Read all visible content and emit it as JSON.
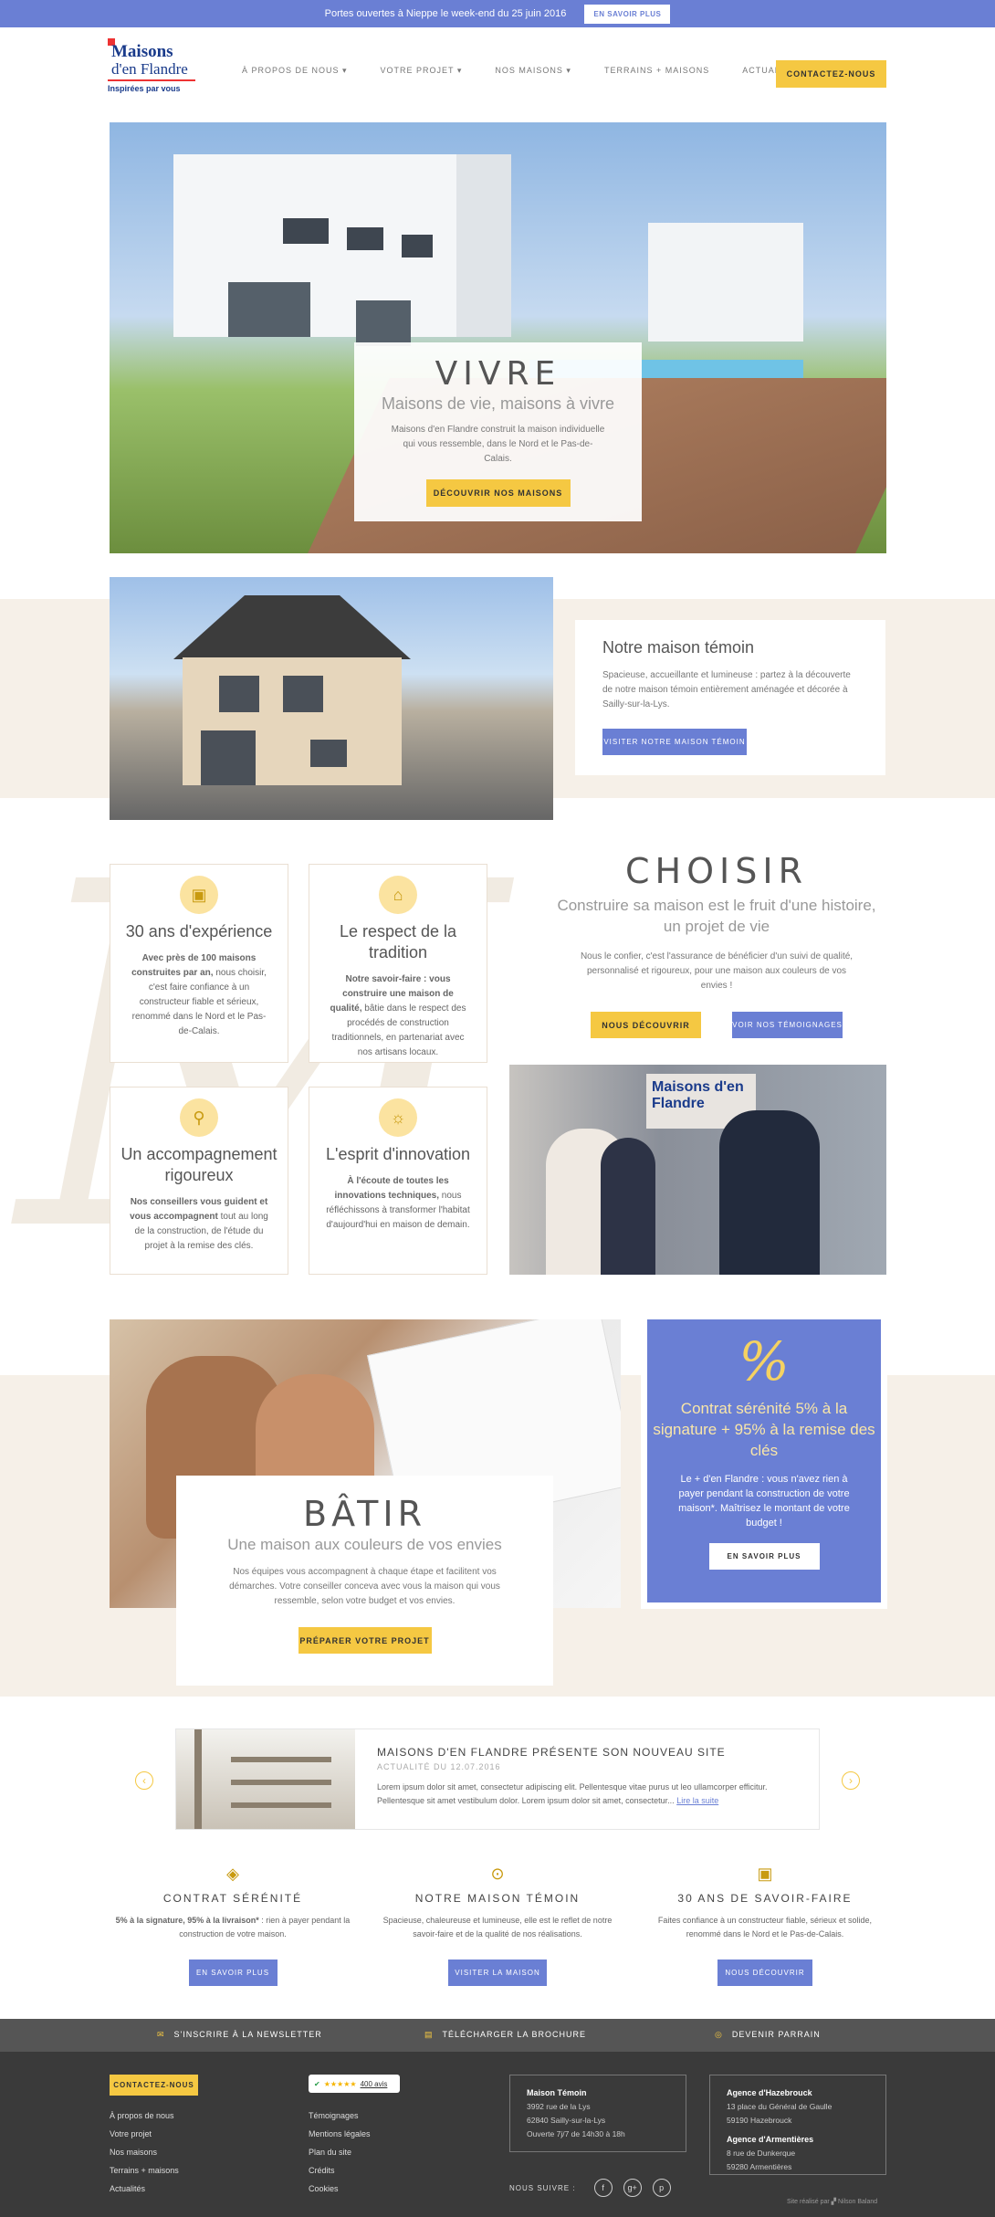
{
  "topbar": {
    "message": "Portes ouvertes à Nieppe le week-end du 25 juin 2016",
    "button": "EN SAVOIR PLUS"
  },
  "logo": {
    "line1": "Maisons",
    "line2": "d'en Flandre",
    "tagline": "Inspirées par vous"
  },
  "nav": {
    "items": [
      "À PROPOS DE NOUS ▾",
      "VOTRE PROJET ▾",
      "NOS MAISONS ▾",
      "TERRAINS + MAISONS",
      "ACTUALITÉS"
    ],
    "cta": "CONTACTEZ-NOUS"
  },
  "hero": {
    "title": "VIVRE",
    "subtitle": "Maisons de vie, maisons à vivre",
    "text": "Maisons d'en Flandre construit la maison individuelle qui vous ressemble, dans le Nord et le Pas-de-Calais.",
    "button": "DÉCOUVRIR NOS MAISONS"
  },
  "temoin": {
    "title": "Notre maison témoin",
    "text": "Spacieuse, accueillante et lumineuse : partez à la découverte de notre maison témoin entièrement aménagée et décorée à Sailly-sur-la-Lys.",
    "button": "VISITER NOTRE MAISON TÉMOIN"
  },
  "features": [
    {
      "icon": "briefcase-icon",
      "glyph": "▣",
      "title": "30 ans d'expérience",
      "bold": "Avec près de 100 maisons construites par an,",
      "text": " nous choisir, c'est faire confiance à un constructeur fiable et sérieux, renommé dans le Nord et le Pas-de-Calais."
    },
    {
      "icon": "home-icon",
      "glyph": "⌂",
      "title": "Le respect de la tradition",
      "bold": "Notre savoir-faire : vous construire une maison de qualité,",
      "text": " bâtie dans le respect des procédés de construction traditionnels, en partenariat avec nos artisans locaux."
    },
    {
      "icon": "magnifier-icon",
      "glyph": "⚲",
      "title": "Un accompagnement rigoureux",
      "bold": "Nos conseillers vous guident et vous accompagnent",
      "text": " tout au long de la construction, de l'étude du projet à la remise des clés."
    },
    {
      "icon": "lightbulb-icon",
      "glyph": "☼",
      "title": "L'esprit d'innovation",
      "bold": "À l'écoute de toutes les innovations techniques,",
      "text": " nous réfléchissons à transformer l'habitat d'aujourd'hui en maison de demain."
    }
  ],
  "choisir": {
    "title": "CHOISIR",
    "subtitle": "Construire sa maison est le fruit d'une histoire, un projet de vie",
    "text": "Nous le confier, c'est l'assurance de bénéficier d'un suivi de qualité, personnalisé et rigoureux, pour une maison aux couleurs de vos envies !",
    "button1": "NOUS DÉCOUVRIR",
    "button2": "VOIR NOS TÉMOIGNAGES",
    "sign": "Maisons d'en Flandre"
  },
  "batir": {
    "title": "BÂTIR",
    "subtitle": "Une maison aux couleurs de vos envies",
    "text": "Nos équipes vous accompagnent à chaque étape et facilitent vos démarches. Votre conseiller conceva avec vous la maison qui vous ressemble, selon votre budget et vos envies.",
    "button": "PRÉPARER VOTRE PROJET"
  },
  "contrat": {
    "symbol": "%",
    "title": "Contrat sérénité 5% à la signature + 95% à la remise des clés",
    "text": "Le + d'en Flandre : vous n'avez rien à payer pendant la construction de votre maison*. Maîtrisez le montant de votre budget !",
    "button": "EN SAVOIR PLUS"
  },
  "news": {
    "title": "MAISONS D'EN FLANDRE PRÉSENTE SON NOUVEAU SITE",
    "date": "ACTUALITÉ DU 12.07.2016",
    "text": "Lorem ipsum dolor sit amet, consectetur adipiscing elit. Pellentesque vitae purus ut leo ullamcorper efficitur. Pellentesque sit amet vestibulum dolor. Lorem ipsum dolor sit amet, consectetur...",
    "link": "Lire la suite",
    "prev": "‹",
    "next": "›"
  },
  "highlights": [
    {
      "icon": "tag-icon",
      "glyph": "◈",
      "title": "CONTRAT SÉRÉNITÉ",
      "bold": "5% à la signature, 95% à la livraison*",
      "text": " : rien à payer pendant la construction de votre maison.",
      "button": "EN SAVOIR PLUS"
    },
    {
      "icon": "map-pin-icon",
      "glyph": "⊙",
      "title": "NOTRE MAISON TÉMOIN",
      "bold": "",
      "text": "Spacieuse, chaleureuse et lumineuse, elle est le reflet de notre savoir-faire et de la qualité de nos réalisations.",
      "button": "VISITER LA MAISON"
    },
    {
      "icon": "briefcase-icon",
      "glyph": "▣",
      "title": "30 ANS DE SAVOIR-FAIRE",
      "bold": "",
      "text": "Faites confiance à un constructeur fiable, sérieux et solide, renommé dans le Nord et le Pas-de-Calais.",
      "button": "NOUS DÉCOUVRIR"
    }
  ],
  "strip": {
    "newsletter": "S'INSCRIRE À LA NEWSLETTER",
    "brochure": "TÉLÉCHARGER LA BROCHURE",
    "parrain": "DEVENIR PARRAIN"
  },
  "footer": {
    "contact": "CONTACTEZ-NOUS",
    "col1": [
      "À propos de nous",
      "Votre projet",
      "Nos maisons",
      "Terrains + maisons",
      "Actualités"
    ],
    "col2": [
      "Témoignages",
      "Mentions légales",
      "Plan du site",
      "Crédits",
      "Cookies"
    ],
    "rating": "★★★★★",
    "rating_count": "400 avis",
    "temoin": {
      "title": "Maison Témoin",
      "l1": "3992 rue de la Lys",
      "l2": "62840 Sailly-sur-la-Lys",
      "l3": "Ouverte 7j/7 de 14h30 à 18h"
    },
    "agences": {
      "t1": "Agence d'Hazebrouck",
      "a1": "13 place du Général de Gaulle",
      "a2": "59190 Hazebrouck",
      "t2": "Agence d'Armentières",
      "b1": "8 rue de Dunkerque",
      "b2": "59280 Armentières"
    },
    "follow": "NOUS SUIVRE :",
    "social": [
      "f",
      "g+",
      "p"
    ],
    "credit": "Site réalisé par ▞ Nilson Baland"
  }
}
